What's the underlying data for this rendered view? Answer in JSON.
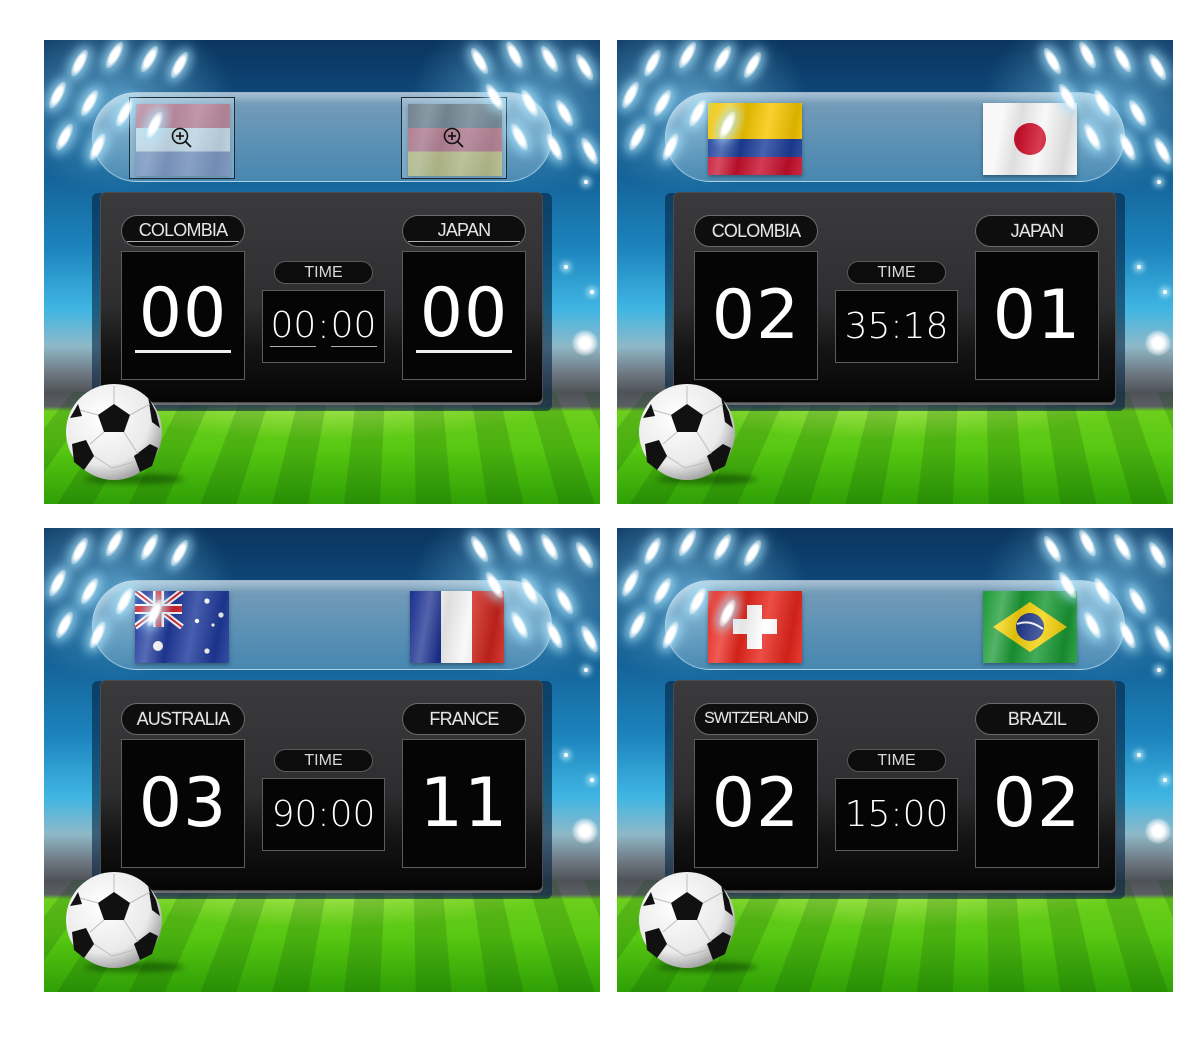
{
  "time_label": "TIME",
  "panels": [
    {
      "mode": "edit",
      "home": {
        "name": "COLOMBIA",
        "score": "00",
        "flag": "placeholder-red-white-blue",
        "flag_picker_icon": "zoom-in-icon"
      },
      "away": {
        "name": "JAPAN",
        "score": "00",
        "flag": "placeholder-black-red-gold",
        "flag_picker_icon": "zoom-in-icon"
      },
      "time": {
        "minutes": "00",
        "seconds": "00",
        "display": "00:00"
      }
    },
    {
      "mode": "display",
      "home": {
        "name": "COLOMBIA",
        "score": "02",
        "flag": "colombia"
      },
      "away": {
        "name": "JAPAN",
        "score": "01",
        "flag": "japan"
      },
      "time": {
        "display": "35:18"
      }
    },
    {
      "mode": "display",
      "home": {
        "name": "AUSTRALIA",
        "score": "03",
        "flag": "australia"
      },
      "away": {
        "name": "FRANCE",
        "score": "11",
        "flag": "france"
      },
      "time": {
        "display": "90:00"
      }
    },
    {
      "mode": "display",
      "home": {
        "name": "SWITZERLAND",
        "score": "02",
        "flag": "switzerland"
      },
      "away": {
        "name": "BRAZIL",
        "score": "02",
        "flag": "brazil"
      },
      "time": {
        "display": "15:00"
      }
    }
  ],
  "colors": {
    "board": "#2c2c2e",
    "digit": "#ffffff",
    "pill_text": "#e6e6e6",
    "sky": "#125a8e",
    "grass": "#58c812"
  }
}
